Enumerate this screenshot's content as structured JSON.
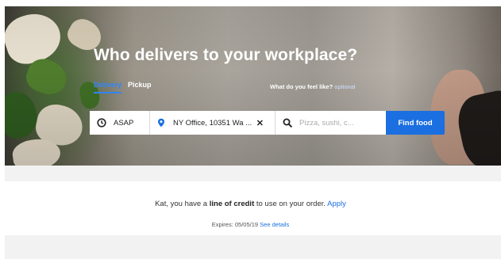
{
  "hero": {
    "headline": "Who delivers to your workplace?",
    "tabs": [
      {
        "label": "Delivery",
        "active": true
      },
      {
        "label": "Pickup",
        "active": false
      }
    ],
    "feel_question": "What do you feel like?",
    "feel_optional": "optional"
  },
  "search": {
    "time_value": "ASAP",
    "address_value": "NY Office, 10351 Wa ...",
    "clear_icon": "close-icon",
    "query_placeholder": "Pizza, sushi, c...",
    "find_button": "Find food"
  },
  "credit": {
    "prefix": "Kat, you have a",
    "bold": "line of credit",
    "suffix": "to use on your order.",
    "apply_link": "Apply",
    "expires_label": "Expires: 05/05/19",
    "details_link": "See details"
  },
  "colors": {
    "accent": "#1b6fe0",
    "active_tab": "#2e86ff"
  }
}
